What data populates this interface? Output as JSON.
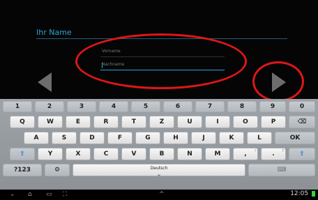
{
  "form": {
    "title": "Ihr Name",
    "first_name_placeholder": "Vorname",
    "last_name_placeholder": "Nachname"
  },
  "keyboard": {
    "row_numbers": [
      "1",
      "2",
      "3",
      "4",
      "5",
      "6",
      "7",
      "8",
      "9",
      "0"
    ],
    "row_1": [
      "Q",
      "W",
      "E",
      "R",
      "T",
      "Z",
      "U",
      "I",
      "O",
      "P"
    ],
    "row_2": [
      "A",
      "S",
      "D",
      "F",
      "G",
      "H",
      "J",
      "K",
      "L"
    ],
    "row_3": [
      "Y",
      "X",
      "C",
      "V",
      "B",
      "N",
      "M"
    ],
    "keys": {
      "enter": "OK",
      "backspace": "⌫",
      "shift_left": "⇧",
      "shift_right": "⇧",
      "comma": ",",
      "comma_sub": "!",
      "period": ".",
      "period_sub": "?",
      "symbols": "?123",
      "settings": "⚙",
      "space_label": "Deutsch",
      "space_icon": "⎵",
      "hide_keyboard": "⌨"
    }
  },
  "nav": {
    "back_icon": "⌄",
    "home_icon": "⌂",
    "recent_icon": "▭",
    "screenshot_icon": "⛶",
    "up_icon": "^",
    "time": "12:05"
  },
  "colors": {
    "accent": "#2aa3d8",
    "annotation": "#e01616"
  }
}
